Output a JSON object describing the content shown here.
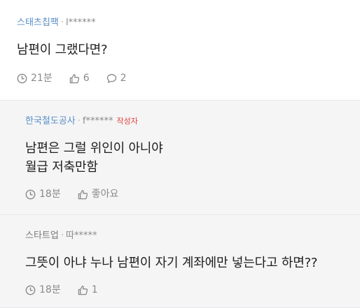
{
  "comments": [
    {
      "company": "스태츠칩팩",
      "author": "l******",
      "text_lines": [
        "남편이 그랬다면?"
      ],
      "time": "21분",
      "likes": "6",
      "replies": "2"
    },
    {
      "company": "한국철도공사",
      "author": "f******",
      "badge": "작성자",
      "text_lines": [
        "남편은 그럴 위인이 아니야",
        "월급 저축만함"
      ],
      "time": "18분",
      "likes": "좋아요"
    },
    {
      "company": "스타트업",
      "author": "따*****",
      "text_lines": [
        "그뜻이 아냐 누나 남편이 자기 계좌에만 넣는다고 하면??"
      ],
      "time": "18분",
      "likes": "1"
    }
  ],
  "icons": {
    "clock": "clock-icon",
    "like": "thumbs-up-icon",
    "reply": "speech-bubble-icon"
  },
  "colors": {
    "company_link": "#5a8fc6",
    "author_badge": "#e2453c",
    "reply_background": "#f5f5f6",
    "meta_text": "#8a8a8a"
  }
}
